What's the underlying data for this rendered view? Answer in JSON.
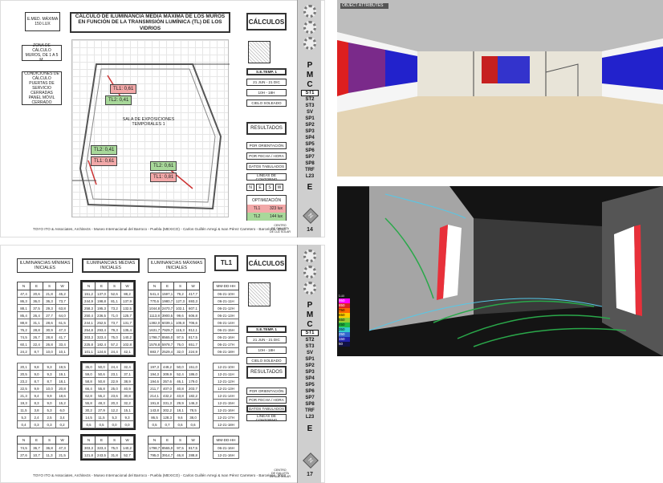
{
  "page1": {
    "emed": "E.MED. MÁXIMA\n150 LUX",
    "title": "CÁLCULO DE ILUMINANCIA MEDIA MÁXIMA DE LOS MUROS\nEN FUNCIÓN DE LA TRANSMISIÓN LUMÍNICA (TL) DE LOS VIDRIOS",
    "zona": "ZONA DE CÁLCULO\nMUROS, DE 1 A 5 M.",
    "condiciones": "CONDICIONES DE\nCÁLCULO\nPUERTAS DE SERVICIO\nCERRADAS\nPANEL MÓVIL\nCERRADO",
    "room_label": "SALA DE EXPOSICIONES\nTEMPORALES 1",
    "tags": [
      "TL1: 0,61",
      "TL2: 0,41",
      "TL2: 0,41",
      "TL1: 0,61",
      "TL2: 0,61",
      "TL1: 0,81"
    ],
    "page_no": "14"
  },
  "calc": {
    "title": "CÁLCULOS",
    "setemp": "S.E.TEMP. 1",
    "date": "21 JUN - 21 DIC",
    "hours": "10H - 18H",
    "sky": "CIELO SOLEADO",
    "results": "RESULTADOS",
    "opt_orient": "POR ORIENTACIÓN",
    "opt_date": "POR FECHA / HORA",
    "opt_data": "DATOS TABULADOS",
    "opt_contour": "LÍNEAS DE CONTORNO",
    "nesw": [
      "N",
      "E",
      "S",
      "W"
    ],
    "optim_title": "OPTIMIZACIÓN",
    "optim_rows": [
      [
        "TL1",
        "323 lux"
      ],
      [
        "TL2",
        "144 lux"
      ]
    ],
    "sign": "CENTRO\nDE GALLETA\nDE LUZ SOLAR"
  },
  "nav": {
    "letters": [
      "P",
      "M",
      "C"
    ],
    "codes": [
      "ST1",
      "ST2",
      "ST3",
      "SV",
      "SP1",
      "SP2",
      "SP3",
      "SP4",
      "SP5",
      "SP6",
      "SP7",
      "SP8",
      "TRF",
      "L23"
    ],
    "end": "E"
  },
  "footer": "TOYO ITO & Associates, Architects  -  Museo Internacional del Barroco - Puebla (MEXICO)  -  Carlos Guillén Arregi  &  Ivan Pérez Carretero  -  Barcelona, 2013",
  "page2": {
    "h_min": "ILUMINANCIAS MÍNIMAS\nINICIALES",
    "h_med": "ILUMINANCIAS MEDIAS\nINICIALES",
    "h_max": "ILUMINANCIAS MÁXIMAS\nINICIALES",
    "tl": "TL1",
    "page_no": "17",
    "cols": [
      "N",
      "E",
      "S",
      "W"
    ],
    "time_header": "MM-DD-HH",
    "min_rows": [
      [
        "47,4",
        "20,6",
        "21,8",
        "45,2"
      ],
      [
        "86,3",
        "36,0",
        "36,3",
        "73,7"
      ],
      [
        "88,1",
        "37,5",
        "29,3",
        "63,8"
      ],
      [
        "85,4",
        "26,4",
        "27,7",
        "64,0"
      ],
      [
        "88,8",
        "31,1",
        "28,6",
        "61,5"
      ],
      [
        "76,2",
        "28,8",
        "30,9",
        "47,3"
      ],
      [
        "74,5",
        "26,7",
        "28,8",
        "41,7"
      ],
      [
        "60,1",
        "22,4",
        "26,8",
        "33,4"
      ],
      [
        "24,2",
        "8,7",
        "10,0",
        "10,1"
      ]
    ],
    "med_rows": [
      [
        "151,2",
        "137,0",
        "52,6",
        "88,2"
      ],
      [
        "244,9",
        "198,8",
        "81,1",
        "137,9"
      ],
      [
        "258,3",
        "195,3",
        "73,2",
        "132,5"
      ],
      [
        "250,4",
        "236,5",
        "71,0",
        "125,7"
      ],
      [
        "244,1",
        "252,5",
        "73,7",
        "131,7"
      ],
      [
        "254,8",
        "293,4",
        "79,3",
        "135,4"
      ],
      [
        "303,3",
        "323,4",
        "75,0",
        "140,2"
      ],
      [
        "225,8",
        "182,4",
        "57,2",
        "102,8"
      ],
      [
        "101,1",
        "124,6",
        "24,4",
        "42,1"
      ]
    ],
    "max_rows": [
      [
        "541,4",
        "1597,1",
        "79,2",
        "417,7"
      ],
      [
        "770,6",
        "1980,7",
        "127,3",
        "693,3"
      ],
      [
        "1044,8",
        "2470,7",
        "102,1",
        "607,1"
      ],
      [
        "1113,8",
        "3900,5",
        "99,6",
        "606,8"
      ],
      [
        "1382,0",
        "6039,1",
        "105,8",
        "706,6"
      ],
      [
        "1631,7",
        "7929,7",
        "115,3",
        "812,1"
      ],
      [
        "1798,7",
        "8565,0",
        "97,5",
        "817,5"
      ],
      [
        "1578,8",
        "5978,7",
        "76,0",
        "651,7"
      ],
      [
        "883,7",
        "2529,4",
        "32,0",
        "224,9"
      ]
    ],
    "times_a": [
      "06-21-10H",
      "06-21-11H",
      "06-21-12H",
      "06-21-13H",
      "06-21-14H",
      "06-21-15H",
      "06-21-16H",
      "06-21-17H",
      "06-21-18H"
    ],
    "min_rows_b": [
      [
        "20,1",
        "9,8",
        "9,3",
        "19,5"
      ],
      [
        "20,5",
        "9,0",
        "9,3",
        "19,1"
      ],
      [
        "23,2",
        "8,7",
        "8,7",
        "18,1"
      ],
      [
        "22,5",
        "9,9",
        "10,0",
        "20,8"
      ],
      [
        "21,3",
        "9,4",
        "9,9",
        "18,6"
      ],
      [
        "19,3",
        "8,3",
        "9,0",
        "15,2"
      ],
      [
        "11,5",
        "3,8",
        "5,3",
        "6,0"
      ],
      [
        "5,3",
        "2,4",
        "2,5",
        "3,4"
      ],
      [
        "0,4",
        "0,3",
        "0,3",
        "0,2"
      ]
    ],
    "med_rows_b": [
      [
        "35,0",
        "50,0",
        "24,4",
        "32,4"
      ],
      [
        "59,0",
        "50,6",
        "23,1",
        "37,1"
      ],
      [
        "58,8",
        "50,8",
        "22,9",
        "38,9"
      ],
      [
        "66,4",
        "55,8",
        "25,0",
        "40,9"
      ],
      [
        "62,8",
        "55,2",
        "23,6",
        "30,8"
      ],
      [
        "55,8",
        "48,3",
        "20,3",
        "32,2"
      ],
      [
        "30,2",
        "27,9",
        "12,2",
        "15,1"
      ],
      [
        "14,5",
        "11,5",
        "5,3",
        "9,3"
      ],
      [
        "0,5",
        "0,5",
        "0,0",
        "0,0"
      ]
    ],
    "max_rows_b": [
      [
        "197,3",
        "449,2",
        "50,0",
        "151,0"
      ],
      [
        "194,3",
        "309,9",
        "52,4",
        "186,0"
      ],
      [
        "194,6",
        "357,6",
        "46,1",
        "179,0"
      ],
      [
        "211,7",
        "407,0",
        "40,8",
        "203,7"
      ],
      [
        "214,1",
        "432,2",
        "43,8",
        "182,2"
      ],
      [
        "191,8",
        "331,3",
        "29,9",
        "146,3"
      ],
      [
        "143,8",
        "302,2",
        "18,1",
        "78,5"
      ],
      [
        "86,5",
        "128,3",
        "9,6",
        "38,0"
      ],
      [
        "0,5",
        "0,7",
        "0,6",
        "0,6"
      ]
    ],
    "times_b": [
      "12-21-10H",
      "12-21-11H",
      "12-21-12H",
      "12-21-13H",
      "12-21-14H",
      "12-21-15H",
      "12-21-16H",
      "12-21-17H",
      "12-21-18H"
    ],
    "min_tot": [
      [
        "74,5",
        "36,7",
        "36,8",
        "47,3"
      ],
      [
        "27,6",
        "10,7",
        "11,3",
        "21,5"
      ]
    ],
    "med_tot": [
      [
        "303,3",
        "323,4",
        "75,0",
        "140,2"
      ],
      [
        "121,8",
        "243,5",
        "31,8",
        "52,7"
      ]
    ],
    "max_tot": [
      [
        "1798,7",
        "8565,0",
        "97,5",
        "817,5"
      ],
      [
        "795,0",
        "3914,7",
        "46,8",
        "288,8"
      ]
    ],
    "times_tot": [
      "06-21-16H",
      "12-21-16H"
    ]
  },
  "images": {
    "img1_label": "OBJECT ATTRIBUTES",
    "img2_legend": [
      "Lux",
      "950",
      "850",
      "750",
      "650",
      "550",
      "450",
      "350",
      "250",
      "150",
      "50"
    ]
  }
}
